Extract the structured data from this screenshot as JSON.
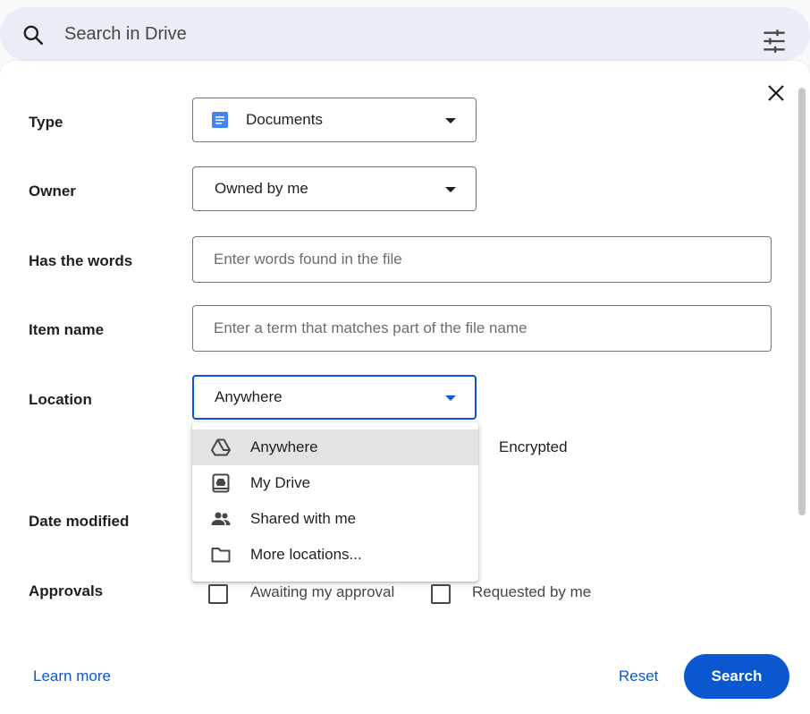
{
  "search": {
    "placeholder": "Search in Drive"
  },
  "form": {
    "type": {
      "label": "Type",
      "value": "Documents"
    },
    "owner": {
      "label": "Owner",
      "value": "Owned by me"
    },
    "words": {
      "label": "Has the words",
      "placeholder": "Enter words found in the file"
    },
    "item_name": {
      "label": "Item name",
      "placeholder": "Enter a term that matches part of the file name"
    },
    "location": {
      "label": "Location",
      "value": "Anywhere"
    },
    "encrypted_label": "Encrypted",
    "date_modified": {
      "label": "Date modified"
    },
    "approvals": {
      "label": "Approvals",
      "options": [
        "Awaiting my approval",
        "Requested by me"
      ]
    }
  },
  "location_menu": {
    "items": [
      {
        "label": "Anywhere",
        "icon": "drive-icon",
        "selected": true
      },
      {
        "label": "My Drive",
        "icon": "my-drive-icon",
        "selected": false
      },
      {
        "label": "Shared with me",
        "icon": "people-icon",
        "selected": false
      },
      {
        "label": "More locations...",
        "icon": "folder-icon",
        "selected": false
      }
    ]
  },
  "footer": {
    "learn_more": "Learn more",
    "reset": "Reset",
    "search": "Search"
  },
  "colors": {
    "accent": "#0b57d0",
    "search_bar_bg": "#e9eef6",
    "doc_icon": "#4285f4",
    "menu_selected_bg": "#e3e3e3"
  }
}
